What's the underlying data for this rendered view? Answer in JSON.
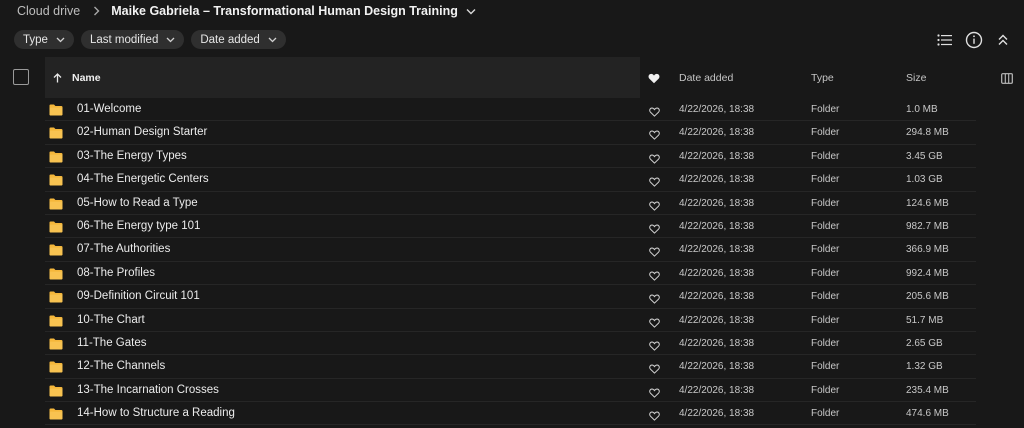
{
  "breadcrumb": {
    "root": "Cloud drive",
    "current": "Maike Gabriela – Transformational Human Design Training"
  },
  "filters": [
    {
      "label": "Type"
    },
    {
      "label": "Last modified"
    },
    {
      "label": "Date added"
    }
  ],
  "toolbar": {
    "icons": [
      "list-view-icon",
      "info-icon",
      "collapse-icon"
    ]
  },
  "table": {
    "headers": {
      "name": "Name",
      "date_added": "Date added",
      "type": "Type",
      "size": "Size"
    },
    "rows": [
      {
        "name": "01-Welcome",
        "date_added": "4/22/2026, 18:38",
        "type": "Folder",
        "size": "1.0 MB"
      },
      {
        "name": "02-Human Design Starter",
        "date_added": "4/22/2026, 18:38",
        "type": "Folder",
        "size": "294.8 MB"
      },
      {
        "name": "03-The Energy Types",
        "date_added": "4/22/2026, 18:38",
        "type": "Folder",
        "size": "3.45 GB"
      },
      {
        "name": "04-The Energetic Centers",
        "date_added": "4/22/2026, 18:38",
        "type": "Folder",
        "size": "1.03 GB"
      },
      {
        "name": "05-How to Read a Type",
        "date_added": "4/22/2026, 18:38",
        "type": "Folder",
        "size": "124.6 MB"
      },
      {
        "name": "06-The Energy type 101",
        "date_added": "4/22/2026, 18:38",
        "type": "Folder",
        "size": "982.7 MB"
      },
      {
        "name": "07-The Authorities",
        "date_added": "4/22/2026, 18:38",
        "type": "Folder",
        "size": "366.9 MB"
      },
      {
        "name": "08-The Profiles",
        "date_added": "4/22/2026, 18:38",
        "type": "Folder",
        "size": "992.4 MB"
      },
      {
        "name": "09-Definition Circuit 101",
        "date_added": "4/22/2026, 18:38",
        "type": "Folder",
        "size": "205.6 MB"
      },
      {
        "name": "10-The Chart",
        "date_added": "4/22/2026, 18:38",
        "type": "Folder",
        "size": "51.7 MB"
      },
      {
        "name": "11-The Gates",
        "date_added": "4/22/2026, 18:38",
        "type": "Folder",
        "size": "2.65 GB"
      },
      {
        "name": "12-The Channels",
        "date_added": "4/22/2026, 18:38",
        "type": "Folder",
        "size": "1.32 GB"
      },
      {
        "name": "13-The Incarnation Crosses",
        "date_added": "4/22/2026, 18:38",
        "type": "Folder",
        "size": "235.4 MB"
      },
      {
        "name": "14-How to Structure a Reading",
        "date_added": "4/22/2026, 18:38",
        "type": "Folder",
        "size": "474.6 MB"
      }
    ]
  },
  "colors": {
    "background": "#181818",
    "header_name_bg": "#232323",
    "chip_bg": "#2f2f2f",
    "folder": "#f5b73b",
    "text": "#ececec"
  }
}
